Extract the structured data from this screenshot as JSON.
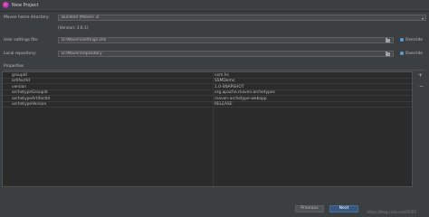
{
  "window": {
    "title": "New Project"
  },
  "maven": {
    "home_label": "Maven home directory:",
    "home_value": "Bundled (Maven 3)",
    "version_note": "(Version: 3.6.1)",
    "settings_label": "User settings file:",
    "settings_value": "D:\\Maven\\settings.xml",
    "settings_override": "Override",
    "repo_label": "Local repository:",
    "repo_value": "D:\\Maven\\repository",
    "repo_override": "Override"
  },
  "properties": {
    "heading": "Properties",
    "rows": [
      {
        "key": "groupId",
        "value": "com.hs"
      },
      {
        "key": "artifactId",
        "value": "SSMDemo"
      },
      {
        "key": "version",
        "value": "1.0-SNAPSHOT"
      },
      {
        "key": "archetypeGroupId",
        "value": "org.apache.maven.archetypes"
      },
      {
        "key": "archetypeArtifactId",
        "value": "maven-archetype-webapp"
      },
      {
        "key": "archetypeVersion",
        "value": "RELEASE"
      }
    ],
    "add_symbol": "+",
    "remove_symbol": "−"
  },
  "buttons": {
    "previous": "Previous",
    "next": "Next"
  },
  "watermark": "https://blog.csdn.net/OYiR2",
  "icons": {
    "app": "intellij-logo-icon",
    "folder": "folder-icon",
    "check": "checkbox-checked-icon"
  },
  "colors": {
    "background": "#3c3f41",
    "accent": "#365880",
    "checkbox": "#4a88c7"
  }
}
